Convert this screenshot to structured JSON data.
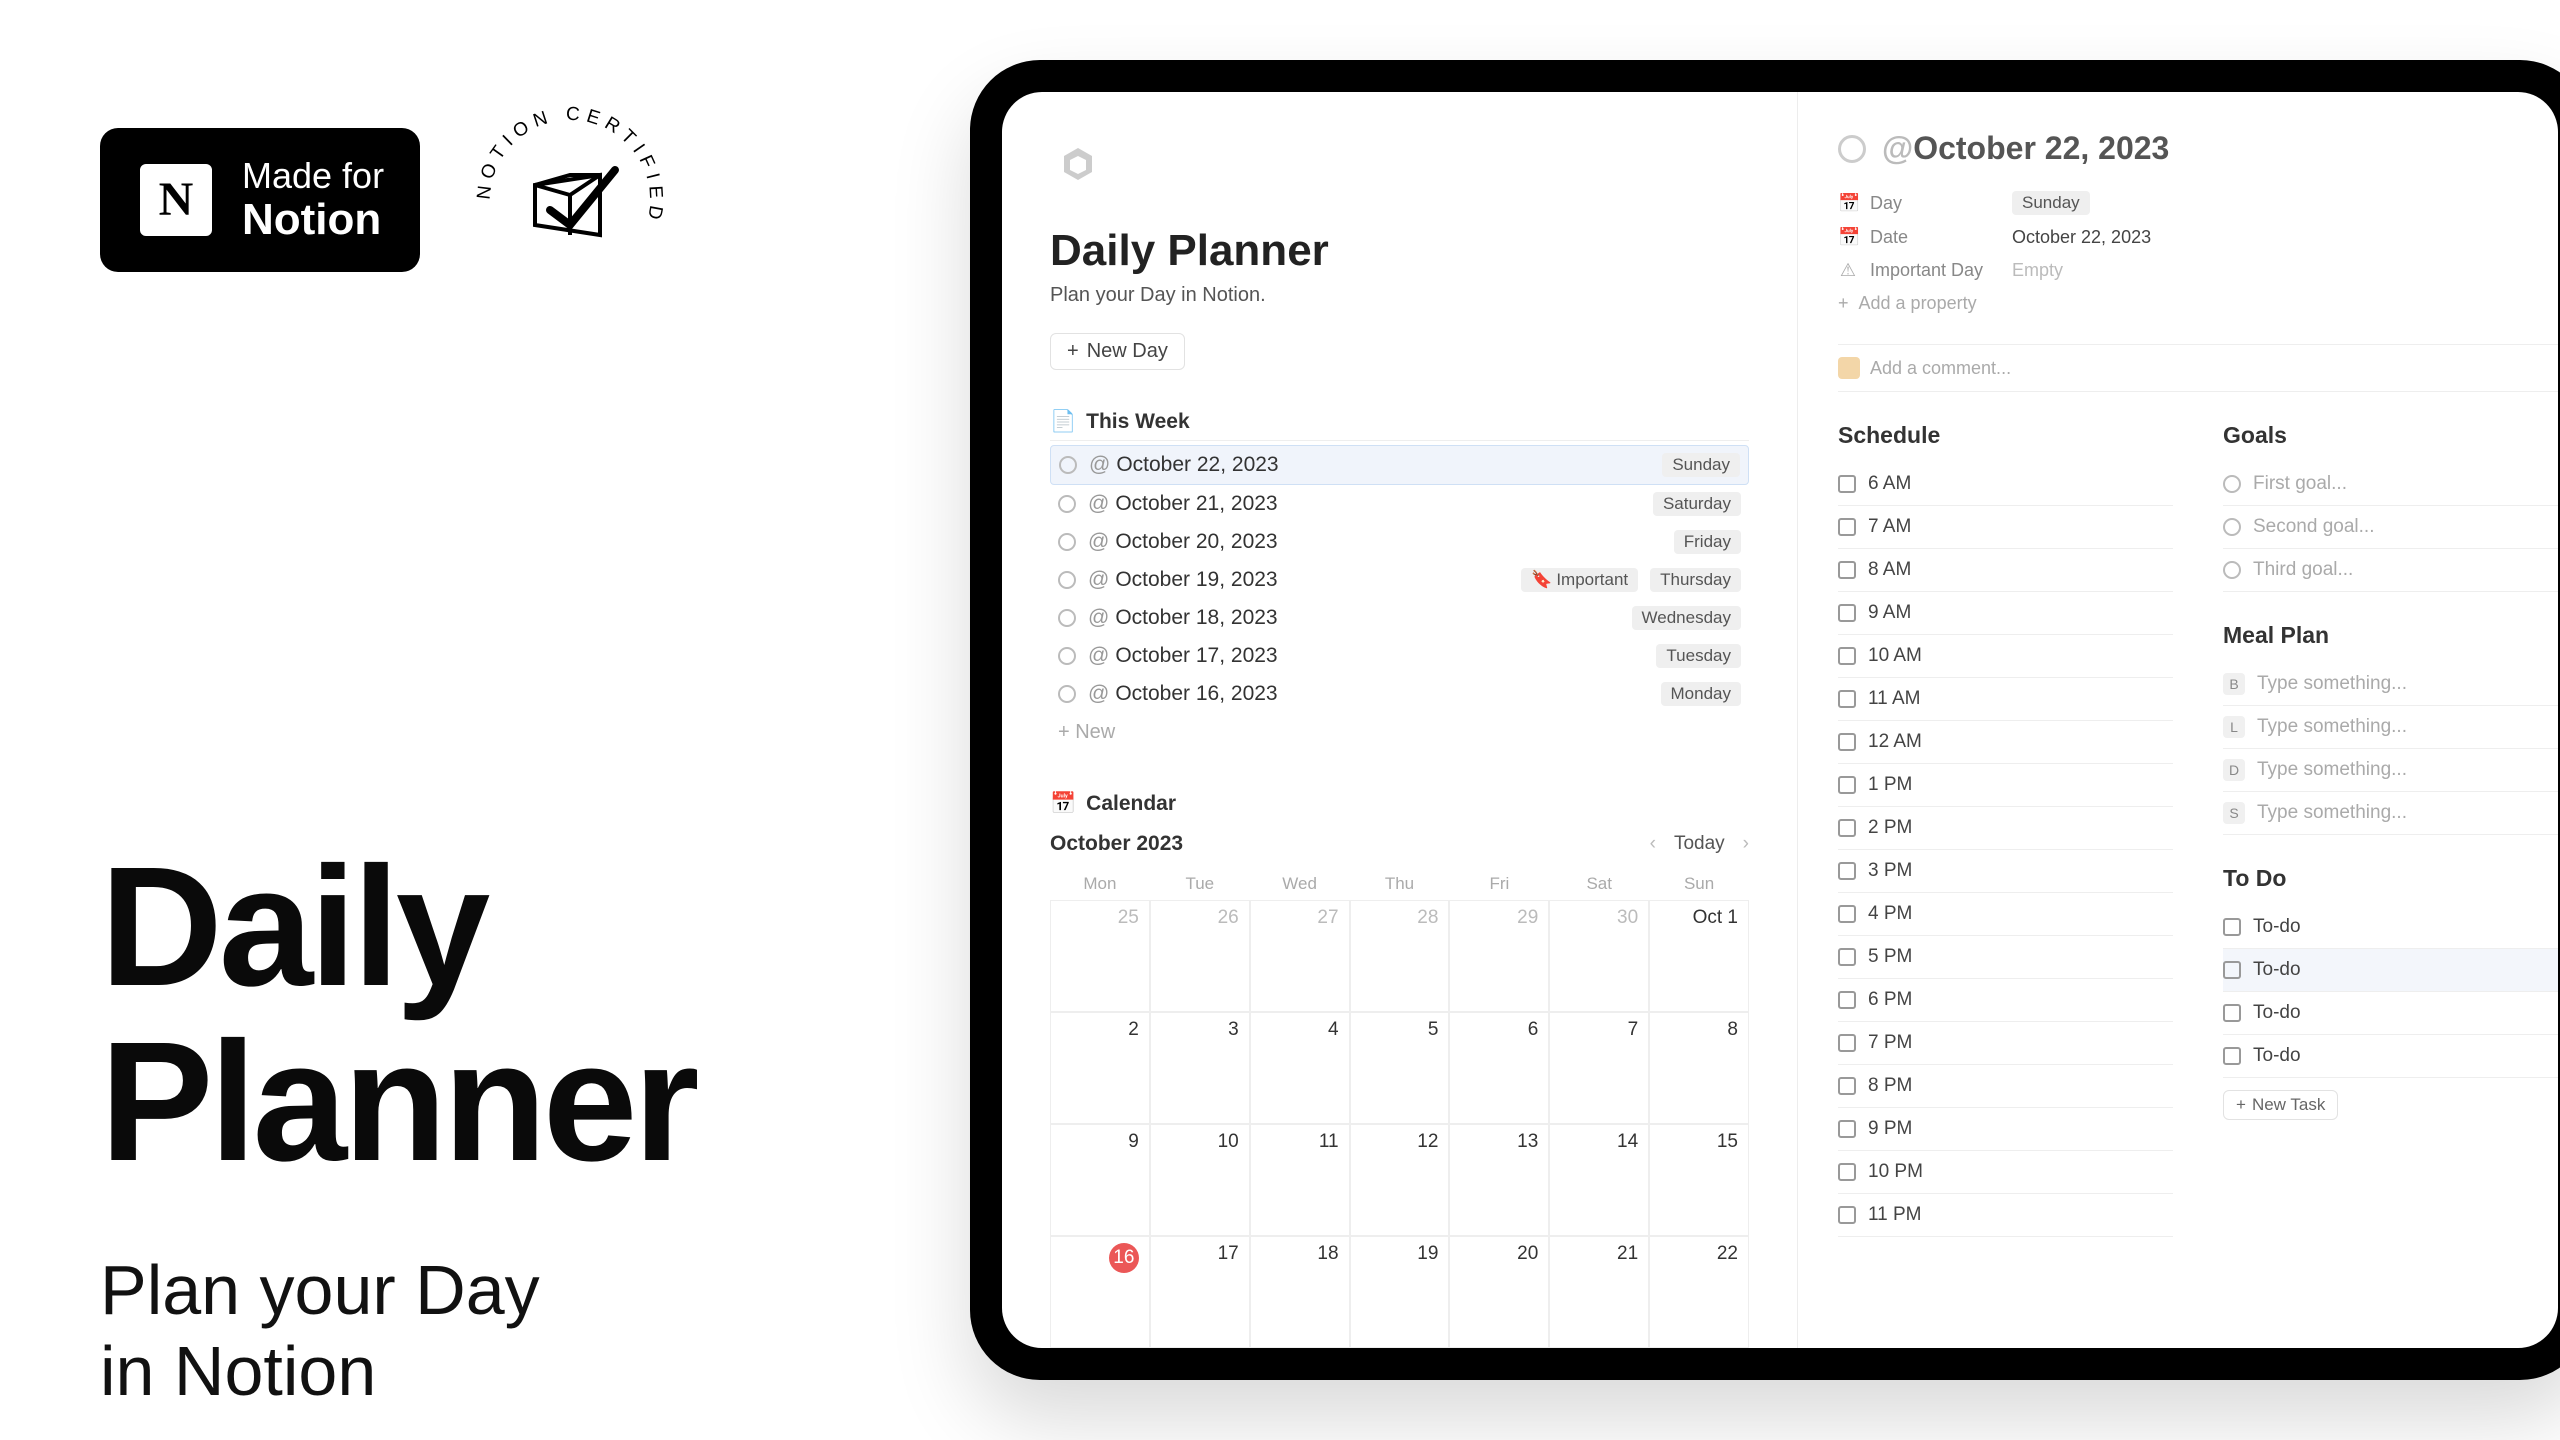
{
  "promo": {
    "badge_line1": "Made for",
    "badge_line2": "Notion",
    "cert_text": "NOTION CERTIFIED",
    "hero_title_l1": "Daily",
    "hero_title_l2": "Planner",
    "hero_sub_l1": "Plan your Day",
    "hero_sub_l2": "in Notion"
  },
  "page": {
    "title": "Daily Planner",
    "description": "Plan your Day in Notion.",
    "new_day_label": "New Day"
  },
  "this_week": {
    "header": "This Week",
    "new_label": "New",
    "items": [
      {
        "name": "October 22, 2023",
        "day": "Sunday",
        "important": false,
        "selected": true
      },
      {
        "name": "October 21, 2023",
        "day": "Saturday",
        "important": false,
        "selected": false
      },
      {
        "name": "October 20, 2023",
        "day": "Friday",
        "important": false,
        "selected": false
      },
      {
        "name": "October 19, 2023",
        "day": "Thursday",
        "important": true,
        "selected": false
      },
      {
        "name": "October 18, 2023",
        "day": "Wednesday",
        "important": false,
        "selected": false
      },
      {
        "name": "October 17, 2023",
        "day": "Tuesday",
        "important": false,
        "selected": false
      },
      {
        "name": "October 16, 2023",
        "day": "Monday",
        "important": false,
        "selected": false
      }
    ],
    "important_label": "Important"
  },
  "calendar": {
    "header": "Calendar",
    "month": "October 2023",
    "today_label": "Today",
    "dow": [
      "Mon",
      "Tue",
      "Wed",
      "Thu",
      "Fri",
      "Sat",
      "Sun"
    ],
    "cells": [
      {
        "n": "25",
        "dim": true
      },
      {
        "n": "26",
        "dim": true
      },
      {
        "n": "27",
        "dim": true
      },
      {
        "n": "28",
        "dim": true
      },
      {
        "n": "29",
        "dim": true
      },
      {
        "n": "30",
        "dim": true
      },
      {
        "n": "Oct 1",
        "dim": false
      },
      {
        "n": "2"
      },
      {
        "n": "3"
      },
      {
        "n": "4"
      },
      {
        "n": "5"
      },
      {
        "n": "6"
      },
      {
        "n": "7"
      },
      {
        "n": "8"
      },
      {
        "n": "9"
      },
      {
        "n": "10"
      },
      {
        "n": "11"
      },
      {
        "n": "12"
      },
      {
        "n": "13"
      },
      {
        "n": "14"
      },
      {
        "n": "15"
      },
      {
        "n": "16",
        "red": true
      },
      {
        "n": "17"
      },
      {
        "n": "18"
      },
      {
        "n": "19"
      },
      {
        "n": "20"
      },
      {
        "n": "21"
      },
      {
        "n": "22"
      }
    ]
  },
  "detail": {
    "title": "October 22, 2023",
    "props": {
      "day_label": "Day",
      "day_value": "Sunday",
      "date_label": "Date",
      "date_value": "October 22, 2023",
      "important_label": "Important Day",
      "important_value": "Empty",
      "add_property": "Add a property",
      "add_comment": "Add a comment..."
    },
    "schedule_title": "Schedule",
    "schedule": [
      "6 AM",
      "7 AM",
      "8 AM",
      "9 AM",
      "10 AM",
      "11 AM",
      "12 AM",
      "1 PM",
      "2 PM",
      "3 PM",
      "4 PM",
      "5 PM",
      "6 PM",
      "7 PM",
      "8 PM",
      "9 PM",
      "10 PM",
      "11 PM"
    ],
    "goals_title": "Goals",
    "goals": [
      "First goal...",
      "Second goal...",
      "Third goal..."
    ],
    "meal_title": "Meal Plan",
    "meal_placeholder": "Type something...",
    "meals": [
      "B",
      "L",
      "D",
      "S"
    ],
    "todo_title": "To Do",
    "todos": [
      "To-do",
      "To-do",
      "To-do",
      "To-do"
    ],
    "new_task": "New Task"
  }
}
